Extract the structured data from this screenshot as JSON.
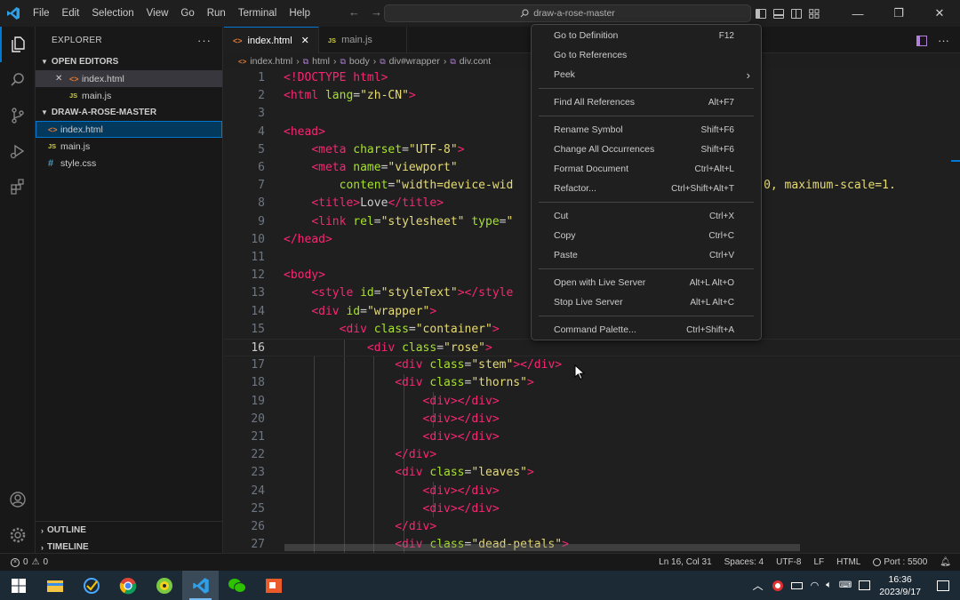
{
  "titlebar": {
    "menus": [
      "File",
      "Edit",
      "Selection",
      "View",
      "Go",
      "Run",
      "Terminal",
      "Help"
    ],
    "search_text": "draw-a-rose-master"
  },
  "sidebar": {
    "title": "EXPLORER",
    "open_editors_title": "OPEN EDITORS",
    "open_editors": [
      {
        "name": "index.html",
        "type": "html",
        "close": "✕"
      },
      {
        "name": "main.js",
        "type": "js"
      }
    ],
    "folder_title": "DRAW-A-ROSE-MASTER",
    "files": [
      {
        "name": "index.html",
        "type": "html"
      },
      {
        "name": "main.js",
        "type": "js"
      },
      {
        "name": "style.css",
        "type": "css"
      }
    ],
    "outline": "OUTLINE",
    "timeline": "TIMELINE"
  },
  "tabs": [
    {
      "label": "index.html",
      "close": "✕"
    },
    {
      "label": "main.js"
    }
  ],
  "breadcrumb": [
    "index.html",
    "html",
    "body",
    "div#wrapper",
    "div.cont"
  ],
  "editor": {
    "current_line": 16,
    "lines": [
      {
        "n": "1",
        "html": "<span class='t'>&lt;!DOCTYPE html&gt;</span>"
      },
      {
        "n": "2",
        "html": "<span class='t'>&lt;html</span> <span class='a'>lang</span>=<span class='s'>\"zh-CN\"</span><span class='t'>&gt;</span>"
      },
      {
        "n": "3",
        "html": ""
      },
      {
        "n": "4",
        "html": "<span class='t'>&lt;head&gt;</span>"
      },
      {
        "n": "5",
        "html": "    <span class='t'>&lt;meta</span> <span class='a'>charset</span>=<span class='s'>\"UTF-8\"</span><span class='t'>&gt;</span>"
      },
      {
        "n": "6",
        "html": "    <span class='t'>&lt;meta</span> <span class='a'>name</span>=<span class='s'>\"viewport\"</span>"
      },
      {
        "n": "7",
        "html": "        <span class='a'>content</span>=<span class='s'>\"width=device-wid</span>                            <span class='s'>scale=1.0, maximum-scale=1.</span>"
      },
      {
        "n": "8",
        "html": "    <span class='t'>&lt;title&gt;</span>Love<span class='t'>&lt;/title&gt;</span>"
      },
      {
        "n": "9",
        "html": "    <span class='t'>&lt;link</span> <span class='a'>rel</span>=<span class='s'>\"stylesheet\"</span> <span class='a'>type</span>=<span class='s'>\"</span>"
      },
      {
        "n": "10",
        "html": "<span class='t'>&lt;/head&gt;</span>"
      },
      {
        "n": "11",
        "html": ""
      },
      {
        "n": "12",
        "html": "<span class='t'>&lt;body&gt;</span>"
      },
      {
        "n": "13",
        "html": "    <span class='t'>&lt;style</span> <span class='a'>id</span>=<span class='s'>\"styleText\"</span><span class='t'>&gt;&lt;/style</span>"
      },
      {
        "n": "14",
        "html": "    <span class='t'>&lt;div</span> <span class='a'>id</span>=<span class='s'>\"wrapper\"</span><span class='t'>&gt;</span>"
      },
      {
        "n": "15",
        "html": "        <span class='t'>&lt;div</span> <span class='a'>class</span>=<span class='s'>\"container\"</span><span class='t'>&gt;</span>"
      },
      {
        "n": "16",
        "html": "            <span class='t'>&lt;div</span> <span class='a'>class</span>=<span class='s'>\"rose\"</span><span class='t'>&gt;</span>"
      },
      {
        "n": "17",
        "html": "                <span class='t'>&lt;div</span> <span class='a'>class</span>=<span class='s'>\"stem\"</span><span class='t'>&gt;&lt;/div&gt;</span>"
      },
      {
        "n": "18",
        "html": "                <span class='t'>&lt;div</span> <span class='a'>class</span>=<span class='s'>\"thorns\"</span><span class='t'>&gt;</span>"
      },
      {
        "n": "19",
        "html": "                    <span class='t'>&lt;div&gt;&lt;/div&gt;</span>"
      },
      {
        "n": "20",
        "html": "                    <span class='t'>&lt;div&gt;&lt;/div&gt;</span>"
      },
      {
        "n": "21",
        "html": "                    <span class='t'>&lt;div&gt;&lt;/div&gt;</span>"
      },
      {
        "n": "22",
        "html": "                <span class='t'>&lt;/div&gt;</span>"
      },
      {
        "n": "23",
        "html": "                <span class='t'>&lt;div</span> <span class='a'>class</span>=<span class='s'>\"leaves\"</span><span class='t'>&gt;</span>"
      },
      {
        "n": "24",
        "html": "                    <span class='t'>&lt;div&gt;&lt;/div&gt;</span>"
      },
      {
        "n": "25",
        "html": "                    <span class='t'>&lt;div&gt;&lt;/div&gt;</span>"
      },
      {
        "n": "26",
        "html": "                <span class='t'>&lt;/div&gt;</span>"
      },
      {
        "n": "27",
        "html": "                <span class='t'>&lt;div</span> <span class='a'>class</span>=<span class='s'>\"dead-petals\"</span><span class='t'>&gt;</span>"
      }
    ]
  },
  "context_menu": {
    "groups": [
      [
        {
          "label": "Go to Definition",
          "key": "F12"
        },
        {
          "label": "Go to References",
          "key": ""
        },
        {
          "label": "Peek",
          "key": "›"
        }
      ],
      [
        {
          "label": "Find All References",
          "key": "Alt+F7"
        }
      ],
      [
        {
          "label": "Rename Symbol",
          "key": "Shift+F6"
        },
        {
          "label": "Change All Occurrences",
          "key": "Shift+F6"
        },
        {
          "label": "Format Document",
          "key": "Ctrl+Alt+L"
        },
        {
          "label": "Refactor...",
          "key": "Ctrl+Shift+Alt+T"
        }
      ],
      [
        {
          "label": "Cut",
          "key": "Ctrl+X"
        },
        {
          "label": "Copy",
          "key": "Ctrl+C"
        },
        {
          "label": "Paste",
          "key": "Ctrl+V"
        }
      ],
      [
        {
          "label": "Open with Live Server",
          "key": "Alt+L Alt+O"
        },
        {
          "label": "Stop Live Server",
          "key": "Alt+L Alt+C"
        }
      ],
      [
        {
          "label": "Command Palette...",
          "key": "Ctrl+Shift+A"
        }
      ]
    ]
  },
  "statusbar": {
    "errors": "0",
    "warnings": "0",
    "position": "Ln 16, Col 31",
    "spaces": "Spaces: 4",
    "encoding": "UTF-8",
    "eol": "LF",
    "language": "HTML",
    "port": "Port : 5500"
  },
  "taskbar": {
    "time": "16:36",
    "date": "2023/9/17"
  }
}
